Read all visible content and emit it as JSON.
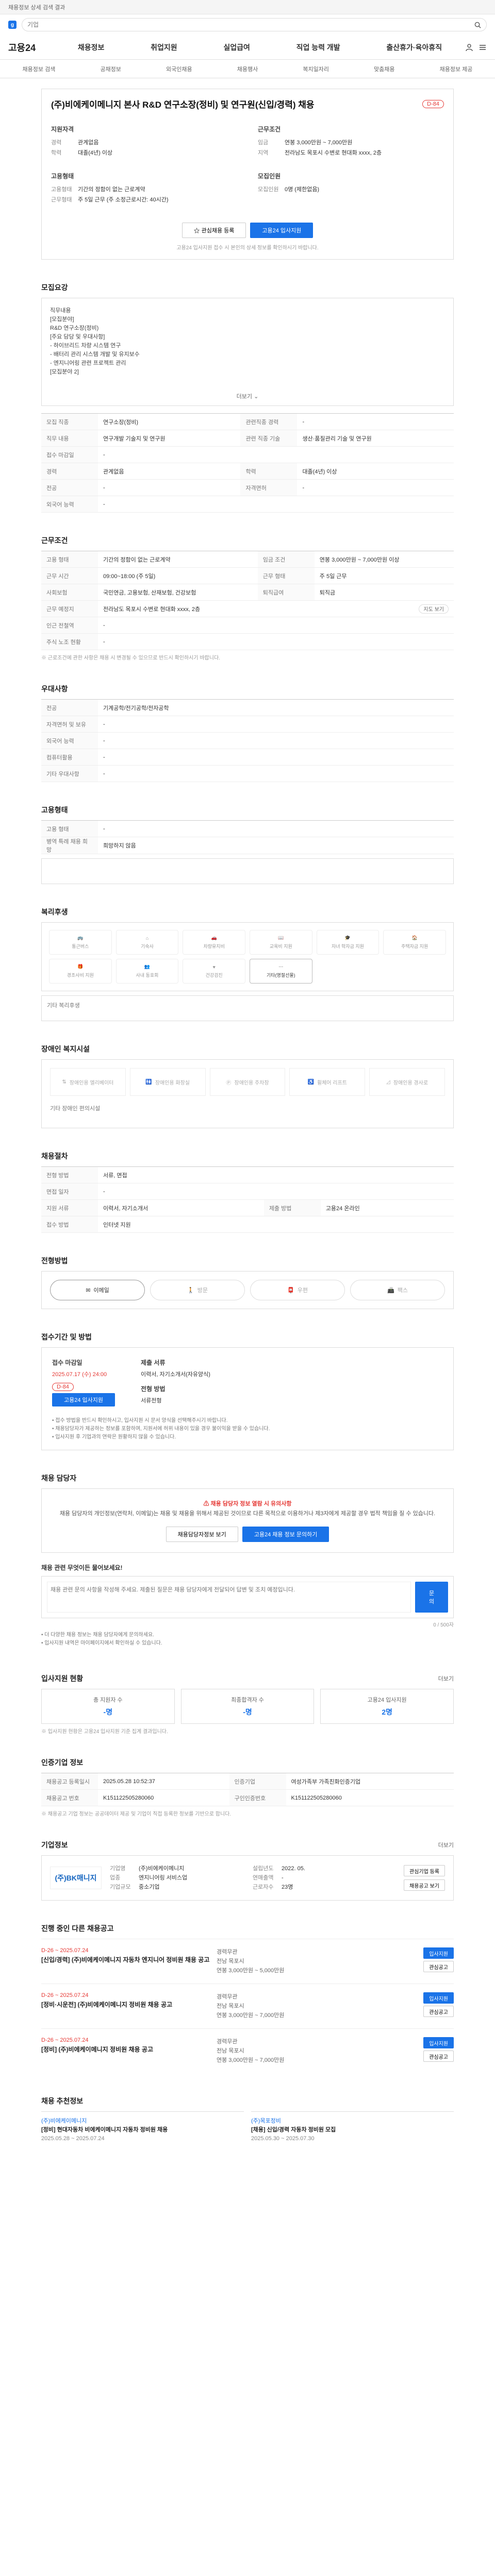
{
  "top_banner": {
    "text": "채용정보 상세 검색 결과"
  },
  "search": {
    "placeholder": "기업"
  },
  "gnb": {
    "brand": "고용24",
    "menu": [
      "채용정보",
      "취업지원",
      "실업급여",
      "직업 능력 개발",
      "출산휴가·육아휴직"
    ]
  },
  "subnav": [
    "채용정보 검색",
    "공채정보",
    "외국인채용",
    "채용행사",
    "복지일자리",
    "맞춤채용",
    "채용정보 제공"
  ],
  "job": {
    "title": "(주)비에케이메니지 본사 R&D 연구소장(정비) 및 연구원(신입/경력) 채용",
    "dday": "D-84",
    "recruit_header": "지원자격",
    "recruit": [
      {
        "k": "경력",
        "v": "관계없음"
      },
      {
        "k": "학력",
        "v": "대졸(4년) 이상"
      }
    ],
    "work_header": "근무조건",
    "work": [
      {
        "k": "임금",
        "v": "연봉 3,000만원 ~ 7,000만원"
      },
      {
        "k": "지역",
        "v": "전라남도 목포시 수변로 현대화 xxxx, 2층"
      }
    ],
    "employ_header": "고용형태",
    "employ": [
      {
        "k": "고용형태",
        "v": "기간의 정함이 없는 근로계약"
      },
      {
        "k": "근무형태",
        "v": "주 5일 근무 (주 소정근로시간: 40시간)"
      }
    ],
    "apply_header": "모집인원",
    "apply": [
      {
        "k": "모집인원",
        "v": "0명 (제한없음)"
      }
    ],
    "btn_scrap": "관심채용 등록",
    "btn_apply": "고용24 입사지원",
    "notice": "고용24 입사지원 접수 시 본인의 상세 정보를 확인하시기 바랍니다."
  },
  "sections": {
    "overview": "모집요강",
    "conditions": "근무조건",
    "preference": "우대사항",
    "employ_type": "고용형태",
    "benefits": "복리후생",
    "welfare": "장애인 복지시설",
    "process": "채용절차",
    "method": "전형방법",
    "period": "접수기간 및 방법",
    "contact": "채용 담당자",
    "stats": "입사지원 현황",
    "detail": "인증기업 정보",
    "company": "기업정보",
    "others": "진행 중인 다른 채용공고",
    "recommend": "채용 추천정보"
  },
  "desc": {
    "lines": [
      "직무내용",
      "[모집분야]",
      "R&D 연구소장(정비)",
      "",
      "[주요 담당 및 우대사항]",
      "- 하이브리드 차량 시스템 연구",
      "- 배터리 관리 시스템 개발 및 유지보수",
      "- 엔지니어링 관련 프로젝트 관리",
      "",
      "[모집분야 2]",
      "연구원(신입/경력)",
      "- 관련 분야 연구개발 업무"
    ],
    "more": "더보기"
  },
  "overview_rows": [
    {
      "k": "모집 직종",
      "v": "연구소장(정비)",
      "k2": "관련직종 경력",
      "v2": "-"
    },
    {
      "k": "직무 내용",
      "v": "연구개발 기술지 및 연구원",
      "k2": "관련 직종 기술",
      "v2": "생산·품질관리 기술 및 연구원"
    },
    {
      "k": "접수 마감일",
      "v": "-",
      "k2": "",
      "v2": ""
    },
    {
      "k": "경력",
      "v": "관계없음",
      "k2": "학력",
      "v2": "대졸(4년) 이상"
    },
    {
      "k": "전공",
      "v": "-",
      "k2": "자격면허",
      "v2": "-"
    },
    {
      "k": "외국어 능력",
      "v": "-",
      "k2": "",
      "v2": ""
    }
  ],
  "cond_rows": [
    {
      "k": "고용 형태",
      "v": "기간의 정함이 없는 근로계약",
      "k2": "임금 조건",
      "v2": "연봉 3,000만원 ~ 7,000만원 이상"
    },
    {
      "k": "근무 시간",
      "v": "09:00~18:00 (주 5일)",
      "k2": "근무 형태",
      "v2": "주 5일 근무"
    },
    {
      "k": "사회보험",
      "v": "국민연금, 고용보험, 산재보험, 건강보험",
      "k2": "퇴직급여",
      "v2": "퇴직금"
    },
    {
      "k": "근무 예정지",
      "v": "전라남도 목포시 수변로 현대화 xxxx, 2층",
      "k2": "",
      "v2": ""
    },
    {
      "k": "인근 전철역",
      "v": "-",
      "k2": "",
      "v2": ""
    },
    {
      "k": "주식 노조 현황",
      "v": "-",
      "k2": "",
      "v2": ""
    }
  ],
  "cond_note": "※ 근로조건에 관한 사항은 채용 시 변경될 수 있으므로 반드시 확인하시기 바랍니다.",
  "map_button": "지도 보기",
  "pref_rows": [
    {
      "k": "전공",
      "v": "기계공학/전기공학/전자공학"
    },
    {
      "k": "자격면허 및 보유",
      "v": "-"
    },
    {
      "k": "외국어 능력",
      "v": "-"
    },
    {
      "k": "컴퓨터활용",
      "v": "-"
    },
    {
      "k": "기타 우대사항",
      "v": "-"
    }
  ],
  "emp_rows": [
    {
      "k": "고용 형태",
      "v": "-"
    },
    {
      "k": "병역 특례 채용 희망",
      "v": "희망하지 않음"
    }
  ],
  "benefits": [
    "통근버스",
    "기숙사",
    "차량유지비",
    "교육비 지원",
    "자녀 학자금 지원",
    "주택자금 지원",
    "경조사비 지원",
    "사내 동호회",
    "건강검진",
    "기타(명절선물)"
  ],
  "benefits_active_index": 9,
  "benefits_note": "기타 복리후생",
  "welfare_items": [
    "장애인용 엘리베이터",
    "장애인용 화장실",
    "장애인용 주차장",
    "휠체어 리프트",
    "장애인용 경사로"
  ],
  "welfare_note": "기타 장애인 편의시설",
  "process_rows": [
    {
      "k": "전형 방법",
      "v": "서류, 면접"
    },
    {
      "k": "면접 일자",
      "v": "-"
    },
    {
      "k": "지원 서류",
      "v": "이력서, 자기소개서",
      "k2": "제출 방법",
      "v2": "고용24 온라인"
    },
    {
      "k": "접수 방법",
      "v": "인터넷 지원",
      "k2": "",
      "v2": ""
    }
  ],
  "methods": [
    "이메일",
    "방문",
    "우편",
    "팩스"
  ],
  "method_active": 0,
  "period_info": {
    "h1": "접수 마감일",
    "d1": "2025.07.17 (수) 24:00",
    "d1b": "D-84",
    "h2": "제출 서류",
    "d2": "이력서, 자기소개서(자유양식)",
    "h3": "전형 방법",
    "d3": "서류전형",
    "apply_btn": "고용24 입사지원"
  },
  "period_bullets": [
    "• 접수 방법을 반드시 확인하시고, 입사지원 시 문서 양식을 선택해주시기 바랍니다.",
    "• 채용담당자가 제공하는 정보를 포함하며, 지원서에 허위 내용이 있을 경우 불이익을 받을 수 있습니다.",
    "• 입사지원 후 기업과의 연락은 원활하지 않을 수 있습니다."
  ],
  "contact": {
    "warn": "채용 담당자 정보 열람 시 유의사항",
    "text": "채용 담당자의 개인정보(연락처, 이메일)는 채용 및 채용을 위해서 제공된 것이므로 다른 목적으로 이용하거나 제3자에게 제공할 경우 법적 책임을 질 수 있습니다.",
    "btn1": "채용담당자정보 보기",
    "btn2": "고용24 채용 정보 문의하기"
  },
  "qna": {
    "title": "채용 관련 무엇이든 물어보세요!",
    "placeholder": "채용 관련 문의 사항을 작성해 주세요. 제출된 질문은 채용 담당자에게 전달되어 답변 및 조치 예정입니다.",
    "count": "0 / 500자",
    "submit": "문의",
    "notes": [
      "• 더 다양한 채용 정보는 채용 담당자에게 문의하세요.",
      "• 입사지원 내역은 마이페이지에서 확인하실 수 있습니다."
    ]
  },
  "stats": {
    "more": "더보기",
    "cards": [
      {
        "lbl": "총 지원자 수",
        "val": "-명"
      },
      {
        "lbl": "최종합격자 수",
        "val": "-명"
      },
      {
        "lbl": "고용24 입사지원",
        "val": "2명"
      }
    ],
    "note": "※ 입사지원 현황은 고용24 입사지원 기준 집계 결과입니다."
  },
  "detail_rows": [
    {
      "k": "채용공고 등록일시",
      "v": "2025.05.28 10:52:37",
      "k2": "인증기업",
      "v2": "여성가족부 가족친화인증기업"
    },
    {
      "k": "채용공고 번호",
      "v": "K151122505280060",
      "k2": "구인인증번호",
      "v2": "K151122505280060"
    }
  ],
  "detail_note": "※ 채용공고 기업 정보는 공공데이터 제공 및 기업이 직접 등록한 정보를 기반으로 합니다.",
  "company": {
    "logo": "(주)BK매니지",
    "more": "더보기",
    "info": [
      {
        "k": "기업명",
        "v": "(주)비에케이메니지"
      },
      {
        "k": "업종",
        "v": "엔지니어링 서비스업"
      },
      {
        "k": "기업규모",
        "v": "중소기업"
      },
      {
        "k": "설립년도",
        "v": "2022. 05."
      },
      {
        "k": "연매출액",
        "v": "-"
      },
      {
        "k": "근로자수",
        "v": "23명"
      }
    ],
    "btn1": "관심기업 등록",
    "btn2": "채용공고 보기"
  },
  "other_jobs": [
    {
      "dt": "D-26 ~ 2025.07.24",
      "ttl": "[신입/경력] (주)비에케이메니지 자동차 엔지니어 정비원 채용 공고",
      "m1": "경력무관",
      "m2": "전남 목포시",
      "m3": "연봉 3,000만원 ~ 5,000만원",
      "b1": "입사지원",
      "b2": "관심공고"
    },
    {
      "dt": "D-26 ~ 2025.07.24",
      "ttl": "[정비·시운전] (주)비에케이메니지 정비원 채용 공고",
      "m1": "경력무관",
      "m2": "전남 목포시",
      "m3": "연봉 3,000만원 ~ 7,000만원",
      "b1": "입사지원",
      "b2": "관심공고"
    },
    {
      "dt": "D-26 ~ 2025.07.24",
      "ttl": "[정비] (주)비에케이메니지 정비원 채용 공고",
      "m1": "경력무관",
      "m2": "전남 목포시",
      "m3": "연봉 3,000만원 ~ 7,000만원",
      "b1": "입사지원",
      "b2": "관심공고"
    }
  ],
  "recommend": [
    {
      "co": "(주)비에케이메니지",
      "t": "[정비] 현대자동차 비에케이메니지 자동차 정비원 채용",
      "d": "2025.05.28 ~ 2025.07.24"
    },
    {
      "co": "(주)목포정비",
      "t": "[채용] 신입/경력 자동차 정비원 모집",
      "d": "2025.05.30 ~ 2025.07.30"
    }
  ]
}
